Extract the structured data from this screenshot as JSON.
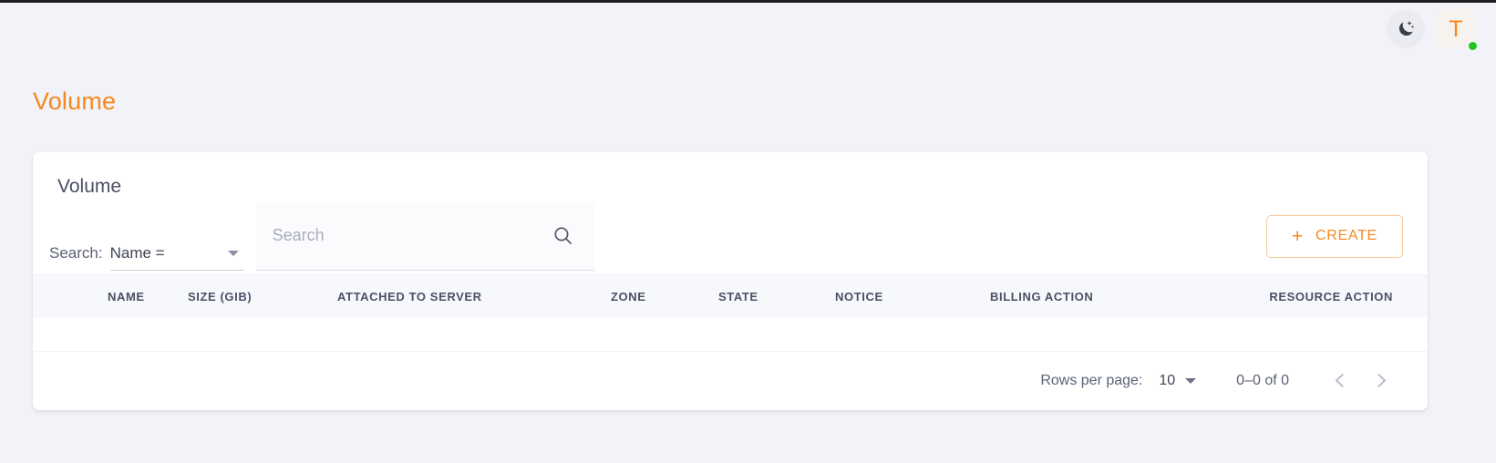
{
  "topbar": {
    "theme_toggle_icon": "moon-stars-icon",
    "avatar_initial": "T",
    "status": "online"
  },
  "page": {
    "title": "Volume",
    "accent_color": "#f6881f",
    "background_color": "#f2f3f9"
  },
  "card": {
    "title": "Volume"
  },
  "toolbar": {
    "search_label": "Search:",
    "filter_value": "Name =",
    "search_value": "",
    "search_placeholder": "Search",
    "search_icon": "magnifier-icon",
    "create_plus": "+",
    "create_label": "CREATE"
  },
  "table": {
    "columns": [
      "NAME",
      "SIZE (GIB)",
      "ATTACHED TO SERVER",
      "ZONE",
      "STATE",
      "NOTICE",
      "BILLING ACTION",
      "RESOURCE ACTION"
    ],
    "rows": []
  },
  "pagination": {
    "rows_per_page_label": "Rows per page:",
    "rows_per_page_value": "10",
    "range_label": "0–0 of 0",
    "prev_icon": "chevron-left-icon",
    "next_icon": "chevron-right-icon"
  }
}
